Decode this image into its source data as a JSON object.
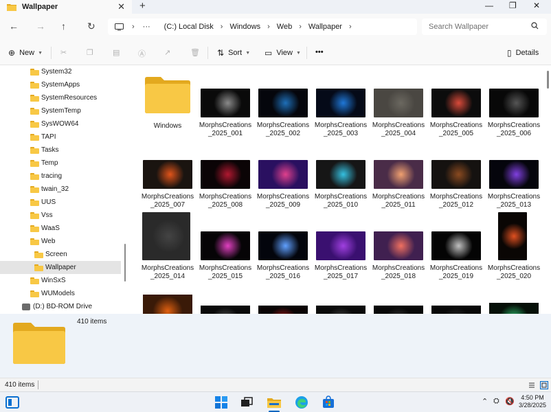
{
  "window": {
    "tab_title": "Wallpaper",
    "tab_close": "✕",
    "new_tab": "+",
    "minimize": "—",
    "maximize": "❐",
    "close": "✕"
  },
  "nav": {
    "back": "←",
    "forward": "→",
    "up": "↑",
    "refresh": "↻",
    "more": "···",
    "breadcrumb": [
      "(C:) Local Disk",
      "Windows",
      "Web",
      "Wallpaper"
    ],
    "search_placeholder": "Search Wallpaper"
  },
  "toolbar": {
    "new_label": "New",
    "sort_label": "Sort",
    "view_label": "View",
    "more_label": "•••",
    "details_label": "Details"
  },
  "sidebar": {
    "items": [
      {
        "label": "System32",
        "type": "folder",
        "indent": 1
      },
      {
        "label": "SystemApps",
        "type": "folder",
        "indent": 1
      },
      {
        "label": "SystemResources",
        "type": "folder",
        "indent": 1
      },
      {
        "label": "SystemTemp",
        "type": "folder",
        "indent": 1
      },
      {
        "label": "SysWOW64",
        "type": "folder",
        "indent": 1
      },
      {
        "label": "TAPI",
        "type": "folder",
        "indent": 1
      },
      {
        "label": "Tasks",
        "type": "folder",
        "indent": 1
      },
      {
        "label": "Temp",
        "type": "folder",
        "indent": 1
      },
      {
        "label": "tracing",
        "type": "folder",
        "indent": 1
      },
      {
        "label": "twain_32",
        "type": "folder",
        "indent": 1
      },
      {
        "label": "UUS",
        "type": "folder",
        "indent": 1
      },
      {
        "label": "Vss",
        "type": "folder",
        "indent": 1
      },
      {
        "label": "WaaS",
        "type": "folder",
        "indent": 1
      },
      {
        "label": "Web",
        "type": "folder",
        "indent": 1
      },
      {
        "label": "Screen",
        "type": "folder",
        "indent": 2
      },
      {
        "label": "Wallpaper",
        "type": "folder",
        "indent": 2,
        "selected": true
      },
      {
        "label": "WinSxS",
        "type": "folder",
        "indent": 1
      },
      {
        "label": "WUModels",
        "type": "folder",
        "indent": 1
      },
      {
        "label": "(D:) BD-ROM Drive",
        "type": "drive",
        "indent": 0
      }
    ]
  },
  "files": [
    {
      "name": "Windows",
      "kind": "folder"
    },
    {
      "name": "MorphsCreations _2025_001",
      "line1": "MorphsCreations",
      "line2": "_2025_001",
      "color": "#0a0a0a",
      "accent": "#8a8a8a"
    },
    {
      "name": "MorphsCreations _2025_002",
      "line1": "MorphsCreations",
      "line2": "_2025_002",
      "color": "#05060c",
      "accent": "#1e6fb8"
    },
    {
      "name": "MorphsCreations _2025_003",
      "line1": "MorphsCreations",
      "line2": "_2025_003",
      "color": "#050a18",
      "accent": "#1f78d8"
    },
    {
      "name": "MorphsCreations _2025_004",
      "line1": "MorphsCreations",
      "line2": "_2025_004",
      "color": "#4a4742",
      "accent": "#6b6860"
    },
    {
      "name": "MorphsCreations _2025_005",
      "line1": "MorphsCreations",
      "line2": "_2025_005",
      "color": "#0c0c0c",
      "accent": "#d84a3a"
    },
    {
      "name": "MorphsCreations _2025_006",
      "line1": "MorphsCreations",
      "line2": "_2025_006",
      "color": "#080808",
      "accent": "#555555"
    },
    {
      "name": "MorphsCreations _2025_007",
      "line1": "MorphsCreations",
      "line2": "_2025_007",
      "color": "#1a1410",
      "accent": "#e0541a"
    },
    {
      "name": "MorphsCreations _2025_008",
      "line1": "MorphsCreations",
      "line2": "_2025_008",
      "color": "#0b0406",
      "accent": "#b01830"
    },
    {
      "name": "MorphsCreations _2025_009",
      "line1": "MorphsCreations",
      "line2": "_2025_009",
      "color": "#2a1060",
      "accent": "#e0408c"
    },
    {
      "name": "MorphsCreations _2025_010",
      "line1": "MorphsCreations",
      "line2": "_2025_010",
      "color": "#161616",
      "accent": "#35c0e0"
    },
    {
      "name": "MorphsCreations _2025_011",
      "line1": "MorphsCreations",
      "line2": "_2025_011",
      "color": "#4a2c48",
      "accent": "#f0a070"
    },
    {
      "name": "MorphsCreations _2025_012",
      "line1": "MorphsCreations",
      "line2": "_2025_012",
      "color": "#151210",
      "accent": "#8a4a20"
    },
    {
      "name": "MorphsCreations _2025_013",
      "line1": "MorphsCreations",
      "line2": "_2025_013",
      "color": "#05050c",
      "accent": "#8040e0"
    },
    {
      "name": "MorphsCreations _2025_014",
      "line1": "MorphsCreations",
      "line2": "_2025_014",
      "color": "#2a2a2a",
      "accent": "#444444",
      "tall": true
    },
    {
      "name": "MorphsCreations _2025_015",
      "line1": "MorphsCreations",
      "line2": "_2025_015",
      "color": "#060406",
      "accent": "#e040c0"
    },
    {
      "name": "MorphsCreations _2025_016",
      "line1": "MorphsCreations",
      "line2": "_2025_016",
      "color": "#03050c",
      "accent": "#60a0ff"
    },
    {
      "name": "MorphsCreations _2025_017",
      "line1": "MorphsCreations",
      "line2": "_2025_017",
      "color": "#3a1070",
      "accent": "#a040e0"
    },
    {
      "name": "MorphsCreations _2025_018",
      "line1": "MorphsCreations",
      "line2": "_2025_018",
      "color": "#402050",
      "accent": "#f07060"
    },
    {
      "name": "MorphsCreations _2025_019",
      "line1": "MorphsCreations",
      "line2": "_2025_019",
      "color": "#040404",
      "accent": "#c0c0c0"
    },
    {
      "name": "MorphsCreations _2025_020",
      "line1": "MorphsCreations",
      "line2": "_2025_020",
      "color": "#0a0604",
      "accent": "#e05020",
      "tall": true
    }
  ],
  "details_pane": {
    "count": "410 items"
  },
  "status": {
    "count": "410 items"
  },
  "clock": {
    "time": "4:50 PM",
    "date": "3/28/2025"
  },
  "colors": {
    "folder": "#f8c845",
    "folder_dark": "#e3a91f",
    "selection": "#e4e4e4",
    "accent": "#0067c0"
  }
}
